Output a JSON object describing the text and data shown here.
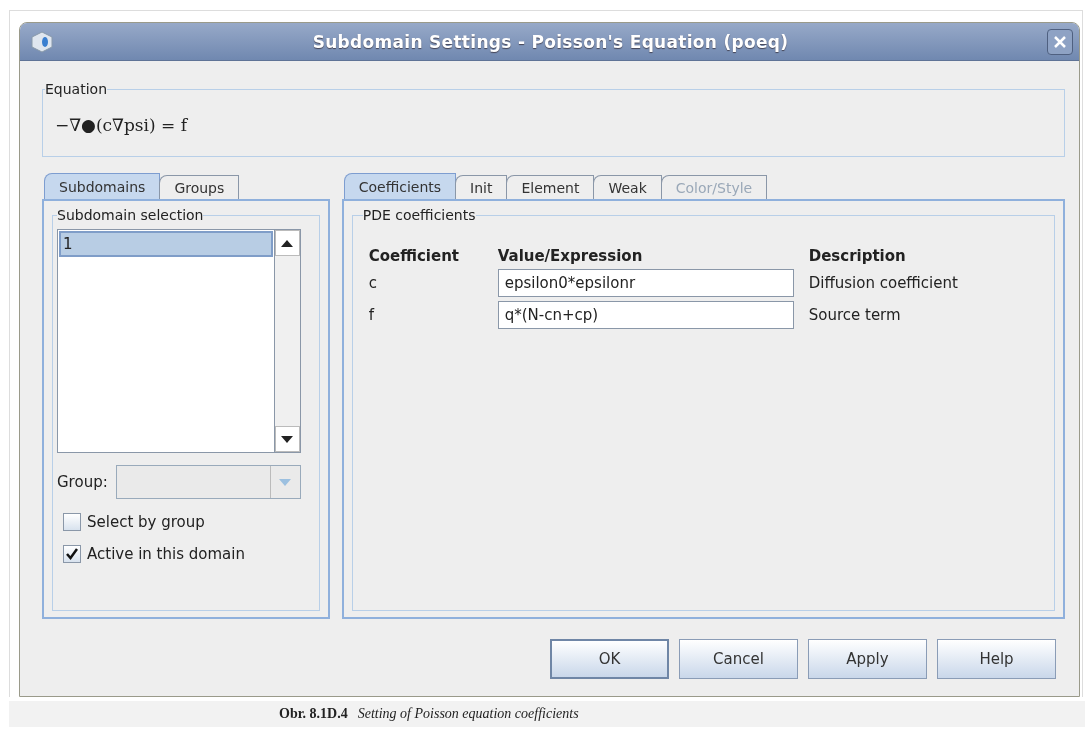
{
  "window": {
    "title": "Subdomain Settings - Poisson's Equation (poeq)"
  },
  "equation": {
    "legend": "Equation",
    "formula": "−∇●(c∇psi) = f"
  },
  "left_tabs": [
    {
      "label": "Subdomains",
      "selected": true
    },
    {
      "label": "Groups",
      "selected": false
    }
  ],
  "subdomain_selection": {
    "legend": "Subdomain selection",
    "items": [
      {
        "label": "1",
        "selected": true
      }
    ]
  },
  "group": {
    "label": "Group:",
    "disabled": true
  },
  "checkboxes": [
    {
      "label": "Select by group",
      "checked": false
    },
    {
      "label": "Active in this domain",
      "checked": true
    }
  ],
  "right_tabs": [
    {
      "label": "Coefficients",
      "selected": true,
      "disabled": false
    },
    {
      "label": "Init",
      "selected": false,
      "disabled": false
    },
    {
      "label": "Element",
      "selected": false,
      "disabled": false
    },
    {
      "label": "Weak",
      "selected": false,
      "disabled": false
    },
    {
      "label": "Color/Style",
      "selected": false,
      "disabled": true
    }
  ],
  "pde": {
    "legend": "PDE coefficients",
    "columns": [
      "Coefficient",
      "Value/Expression",
      "Description"
    ],
    "rows": [
      {
        "coefficient": "c",
        "value": "epsilon0*epsilonr",
        "description": "Diffusion coefficient"
      },
      {
        "coefficient": "f",
        "value": "q*(N-cn+cp)",
        "description": "Source term"
      }
    ]
  },
  "buttons": [
    {
      "label": "OK",
      "default": true
    },
    {
      "label": "Cancel",
      "default": false
    },
    {
      "label": "Apply",
      "default": false
    },
    {
      "label": "Help",
      "default": false
    }
  ],
  "caption": {
    "number": "Obr. 8.1D.4",
    "text": "Setting of Poisson equation coefficients"
  }
}
